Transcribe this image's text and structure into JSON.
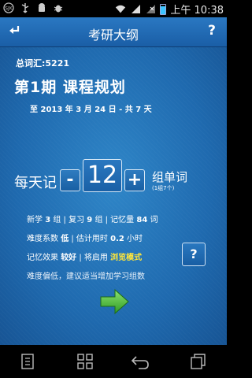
{
  "status_bar": {
    "time": "上午 10:38",
    "icons": [
      "soda-icon",
      "usb-icon",
      "android-icon",
      "bug-icon",
      "wifi-icon",
      "signal-icon",
      "no-signal-icon",
      "battery-icon"
    ]
  },
  "title_bar": {
    "title": "考研大纲",
    "help_label": "?"
  },
  "plan": {
    "total_label": "总词汇:",
    "total_value": "5221",
    "period_title": "第1期 课程规划",
    "date_range": "至 2013 年 3 月 24 日 - 共 7 天",
    "daily_label": "每天记",
    "minus_label": "-",
    "group_count": "12",
    "plus_label": "+",
    "unit_label": "组单词",
    "unit_note": "(1组7个)",
    "stats": {
      "new_label": "新学",
      "new_value": "3",
      "group_unit": "组",
      "review_label": "| 复习",
      "review_value": "9",
      "memory_label": "组 | 记忆量",
      "memory_value": "84",
      "word_unit": "词",
      "difficulty_label": "难度系数",
      "difficulty_value": "低",
      "time_label": "| 估计用时",
      "time_value": "0.2",
      "hour_unit": "小时",
      "effect_label": "记忆效果",
      "effect_value": "较好",
      "enable_label": "| 将启用",
      "mode_value": "浏览模式"
    },
    "hint": "难度偏低，建议适当增加学习组数",
    "question_label": "?"
  },
  "colors": {
    "accent_yellow": "#ffe63a",
    "arrow_green": "#4cc23a",
    "background_blue": "#1f6aaf"
  }
}
